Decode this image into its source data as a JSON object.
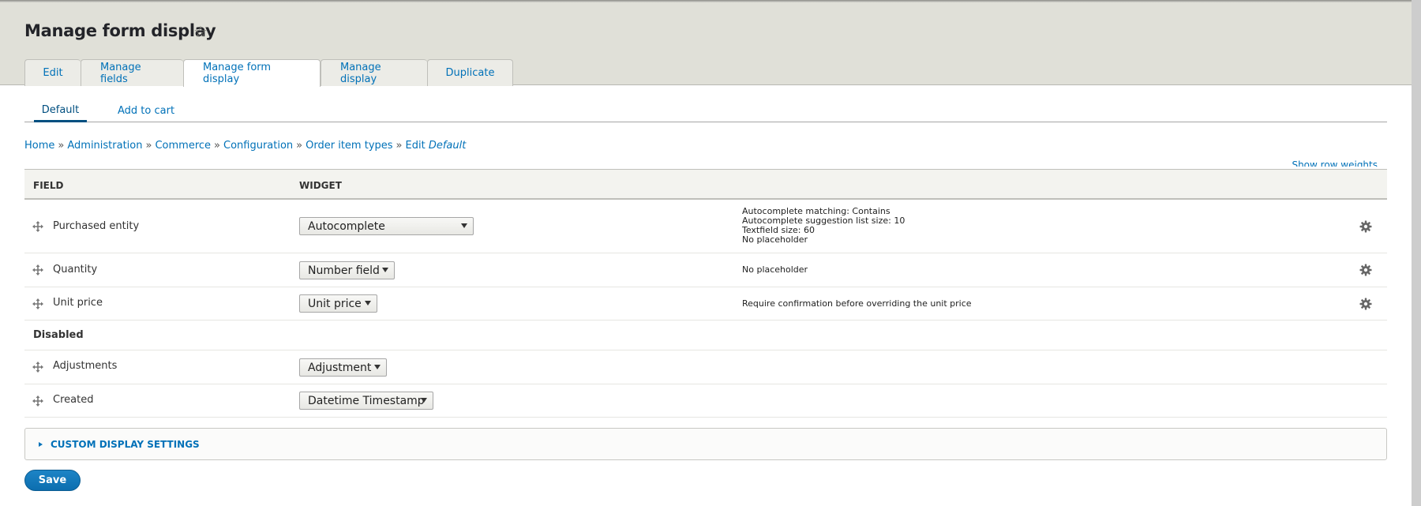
{
  "page": {
    "title": "Manage form display",
    "shortcut_icon": "star-icon"
  },
  "tabs": [
    {
      "label": "Edit",
      "active": false
    },
    {
      "label": "Manage fields",
      "active": false
    },
    {
      "label": "Manage form display",
      "active": true
    },
    {
      "label": "Manage display",
      "active": false
    },
    {
      "label": "Duplicate",
      "active": false
    }
  ],
  "subtabs": [
    {
      "label": "Default",
      "active": true
    },
    {
      "label": "Add to cart",
      "active": false
    }
  ],
  "breadcrumb": {
    "items": [
      "Home",
      "Administration",
      "Commerce",
      "Configuration",
      "Order item types"
    ],
    "separator": "»",
    "last_prefix": "Edit",
    "last_emphasis": "Default"
  },
  "table": {
    "show_row_weights": "Show row weights",
    "columns": {
      "field": "Field",
      "widget": "Widget"
    },
    "rows": [
      {
        "field": "Purchased entity",
        "widget": "Autocomplete",
        "summary": [
          "Autocomplete matching: Contains",
          "Autocomplete suggestion list size: 10",
          "Textfield size: 60",
          "No placeholder"
        ],
        "has_settings": true
      },
      {
        "field": "Quantity",
        "widget": "Number field",
        "summary": [
          "No placeholder"
        ],
        "has_settings": true
      },
      {
        "field": "Unit price",
        "widget": "Unit price",
        "summary": [
          "Require confirmation before overriding the unit price"
        ],
        "has_settings": true
      }
    ],
    "disabled_label": "Disabled",
    "disabled_rows": [
      {
        "field": "Adjustments",
        "widget": "Adjustment"
      },
      {
        "field": "Created",
        "widget": "Datetime Timestamp"
      }
    ]
  },
  "details": {
    "label": "Custom display settings",
    "expanded": false
  },
  "actions": {
    "save_label": "Save"
  },
  "colors": {
    "link": "#0071b8",
    "header_bg": "#e0e0d8",
    "primary_button": "#0c6eaf"
  }
}
